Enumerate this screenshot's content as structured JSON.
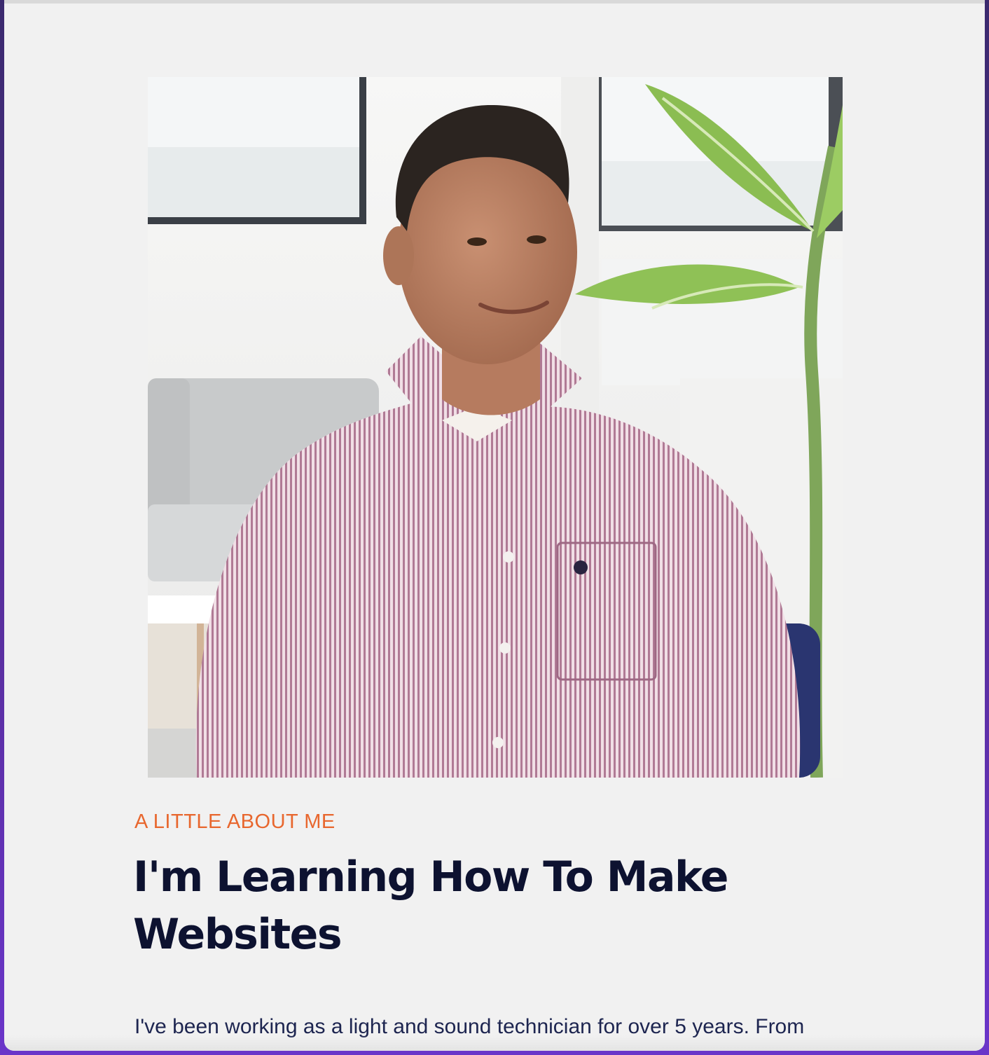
{
  "about": {
    "eyebrow": "A LITTLE ABOUT ME",
    "headline": "I'm Learning How To Make Websites",
    "body": "I've been working as a light and sound technician for over 5 years. From"
  },
  "photo": {
    "alt": "Portrait of a man in a pink striped shirt sitting in a bright office next to a plant"
  },
  "colors": {
    "accent": "#e8672e",
    "heading": "#0d1230",
    "text": "#1d2550",
    "background": "#f1f1f1"
  }
}
